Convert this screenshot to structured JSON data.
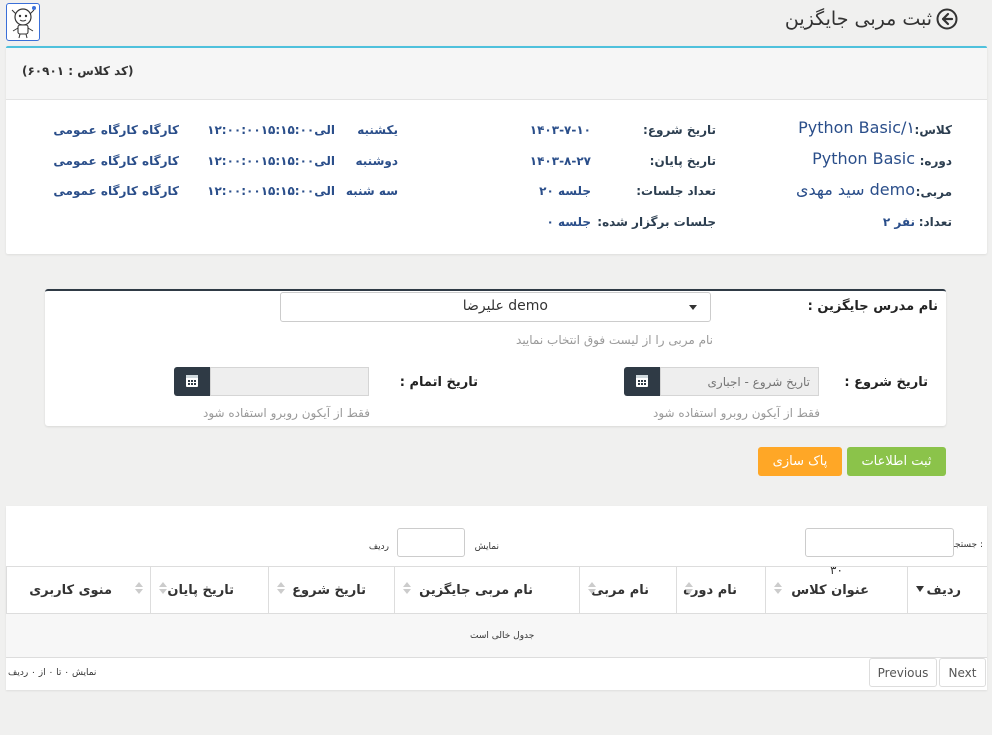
{
  "header": {
    "title": "ثبت مربی جایگزین"
  },
  "class_info": {
    "code": "(کد کلاس : ۶۰۹۰۱)",
    "col1": [
      {
        "label": "کلاس:",
        "value": "Python Basic/۱"
      },
      {
        "label": "دوره:",
        "value": "Python Basic"
      },
      {
        "label": "مربی:",
        "value": "سید مهدی demo"
      },
      {
        "label": "تعداد:",
        "value": "۲ نفر"
      }
    ],
    "col2": [
      {
        "label": "تاریخ شروع:",
        "value": "۱۴۰۳-۷-۱۰"
      },
      {
        "label": "تاریخ پایان:",
        "value": "۱۴۰۳-۸-۲۷"
      },
      {
        "label": "تعداد جلسات:",
        "value": "۲۰ جلسه"
      },
      {
        "label": "جلسات برگزار شده:",
        "value": "۰ جلسه"
      }
    ],
    "schedule": [
      {
        "day": "یکشنبه",
        "time": "۱۲:۰۰:۰۰الی۱۵:۱۵:۰۰",
        "place": "کارگاه کارگاه عمومی"
      },
      {
        "day": "دوشنبه",
        "time": "۱۲:۰۰:۰۰الی۱۵:۱۵:۰۰",
        "place": "کارگاه کارگاه عمومی"
      },
      {
        "day": "سه شنبه",
        "time": "۱۲:۰۰:۰۰الی۱۵:۱۵:۰۰",
        "place": "کارگاه کارگاه عمومی"
      }
    ]
  },
  "form": {
    "coach_label": "نام مدرس جایگزین :",
    "coach_value": "علیرضا demo",
    "coach_hint": "نام مربی را از لیست فوق انتخاب نمایید",
    "start_label": "تاریخ شروع :",
    "start_placeholder": "تاریخ شروع - اجباری",
    "start_hint": "فقط از آیکون روبرو استفاده شود",
    "end_label": "تاریخ اتمام :",
    "end_hint": "فقط از آیکون روبرو استفاده شود",
    "submit_label": "ثبت اطلاعات",
    "clear_label": "پاک سازی"
  },
  "table": {
    "search_label": "جستجو :",
    "show_label": "نمایش",
    "show_count": "۳۰",
    "rows_label": "ردیف",
    "columns": [
      "ردیف",
      "عنوان کلاس",
      "نام دوره",
      "نام مربی",
      "نام مربی جایگزین",
      "تاریخ شروع",
      "تاریخ پایان",
      "منوی کاربری"
    ],
    "empty_text": "جدول خالی است",
    "info_text": "نمایش ۰ تا ۰ از ۰ ردیف",
    "prev_label": "Previous",
    "next_label": "Next"
  },
  "colors": {
    "accent_teal": "#4fc1dc",
    "submit_green": "#8bc34a",
    "clear_orange": "#ffa726",
    "dark_navy": "#2f3a45",
    "value_blue": "#2a4e8a"
  }
}
